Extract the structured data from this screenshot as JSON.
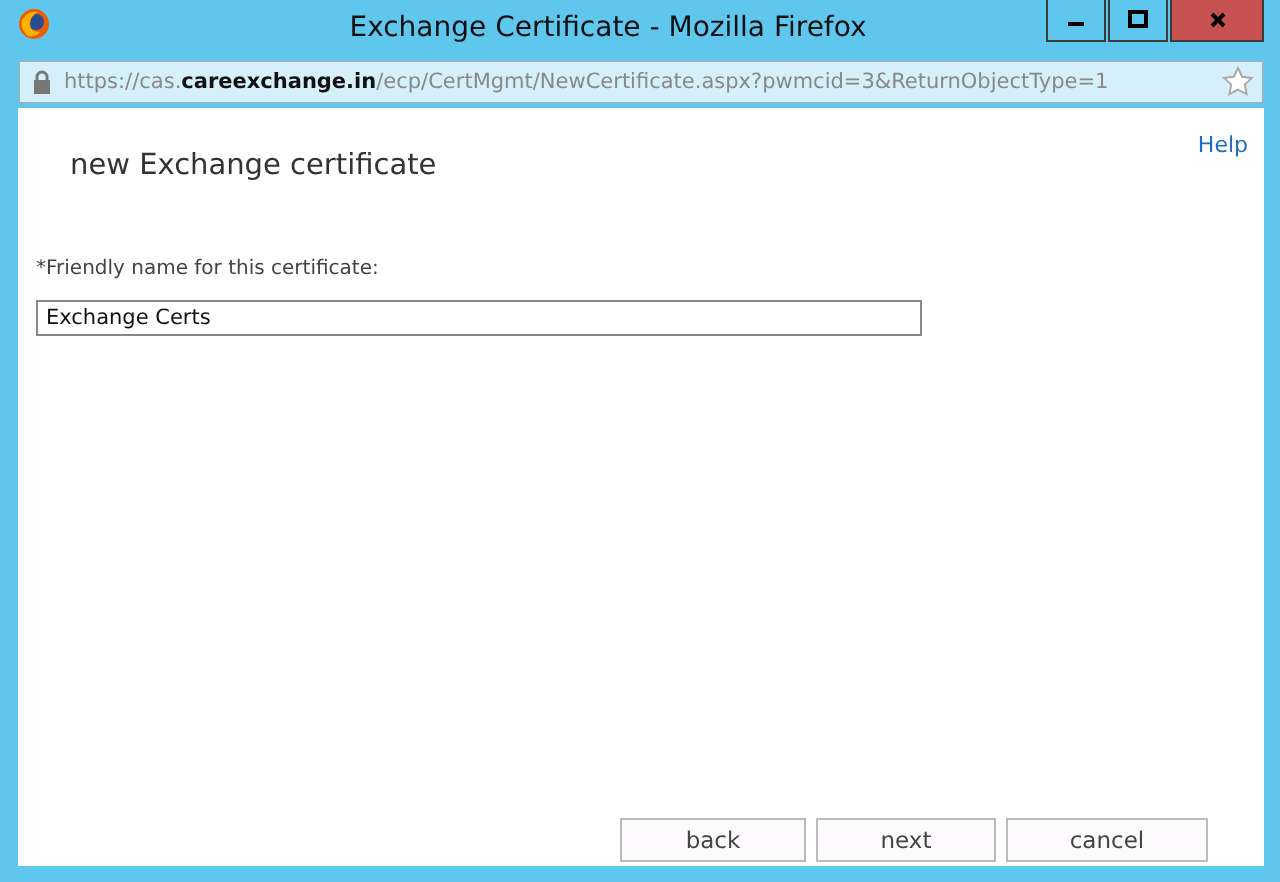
{
  "window": {
    "title": "Exchange Certificate - Mozilla Firefox"
  },
  "address_bar": {
    "url": "https://cas.**careexchange.in**/ecp/CertMgmt/NewCertificate.aspx?pwmcid=3&ReturnObjectType=1"
  },
  "help_link": "Help",
  "heading": "new Exchange certificate",
  "friendly_name": {
    "label": "*Friendly name for this certificate:",
    "value": "Exchange Certs"
  },
  "buttons": [
    {
      "label": "back",
      "disabled": false
    },
    {
      "label": "next",
      "disabled": false
    },
    {
      "label": "cancel",
      "disabled": false
    }
  ]
}
